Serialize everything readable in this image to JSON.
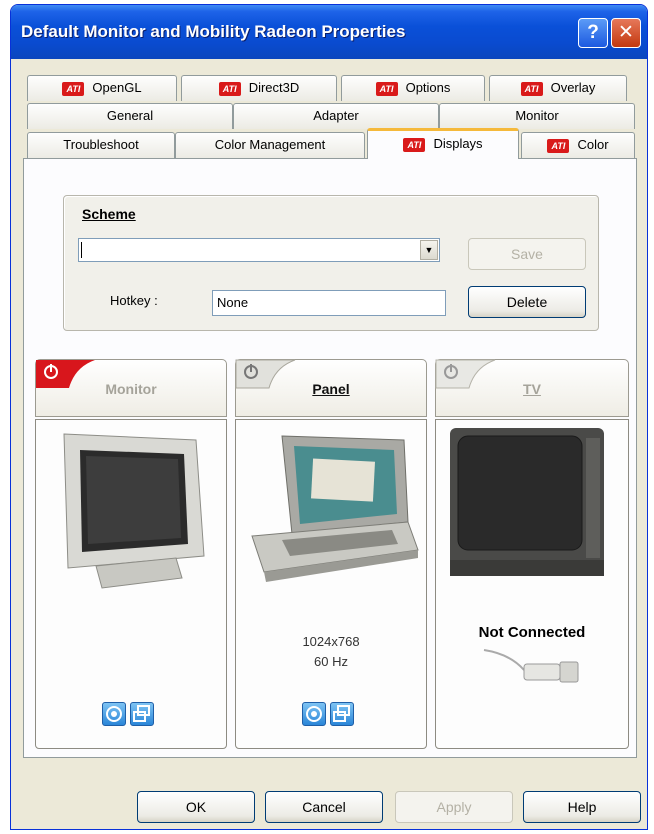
{
  "window": {
    "title": "Default Monitor and Mobility Radeon Properties",
    "help_glyph": "?",
    "close_glyph": "✕"
  },
  "tabs": {
    "row1": [
      {
        "label": "OpenGL",
        "ati": true
      },
      {
        "label": "Direct3D",
        "ati": true
      },
      {
        "label": "Options",
        "ati": true
      },
      {
        "label": "Overlay",
        "ati": true
      }
    ],
    "row2": [
      {
        "label": "General"
      },
      {
        "label": "Adapter"
      },
      {
        "label": "Monitor"
      }
    ],
    "row3": [
      {
        "label": "Troubleshoot"
      },
      {
        "label": "Color Management"
      },
      {
        "label": "Displays",
        "ati": true,
        "active": true
      },
      {
        "label": "Color",
        "ati": true
      }
    ],
    "ati_mark": "ATI"
  },
  "scheme": {
    "label": "Scheme",
    "selected_value": "",
    "dropdown_glyph": "▼",
    "save_label": "Save",
    "hotkey_label": "Hotkey :",
    "hotkey_value": "None",
    "delete_label": "Delete"
  },
  "displays": [
    {
      "label": "Monitor",
      "enabled": true,
      "primary": false
    },
    {
      "label": "Panel",
      "enabled": true,
      "primary": true,
      "resolution": "1024x768",
      "refresh": "60 Hz"
    },
    {
      "label": "TV",
      "enabled": false,
      "status": "Not Connected"
    }
  ],
  "buttons": {
    "ok": "OK",
    "cancel": "Cancel",
    "apply": "Apply",
    "help": "Help"
  },
  "colors": {
    "titlebar": "#0a50d8",
    "active_tab_accent": "#f5b93b",
    "ati_red": "#d91a1a",
    "dialog_bg": "#ece9d8"
  }
}
